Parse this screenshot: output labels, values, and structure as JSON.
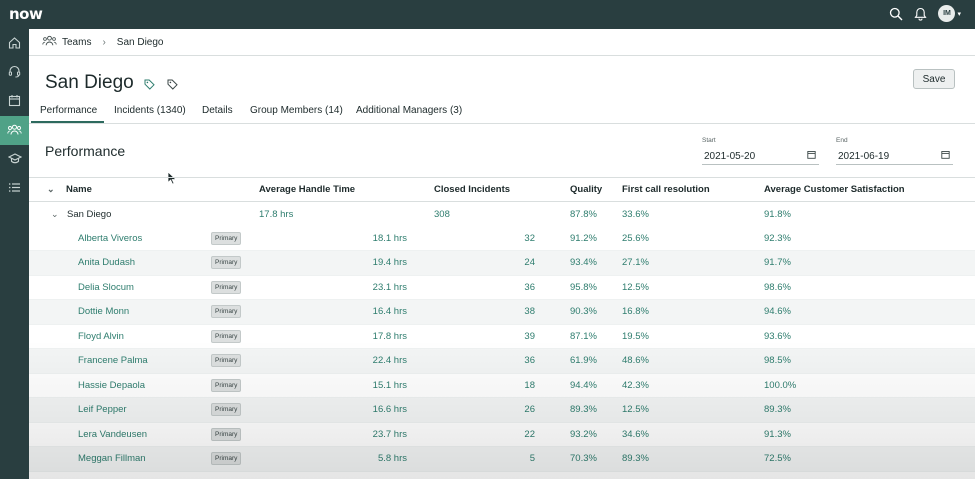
{
  "app": {
    "logo": "now",
    "user_initials": "IM"
  },
  "sidebar": {
    "items": [
      {
        "icon": "home-icon"
      },
      {
        "icon": "headset-icon"
      },
      {
        "icon": "calendar-icon"
      },
      {
        "icon": "teams-icon",
        "active": true
      },
      {
        "icon": "graduation-cap-icon"
      },
      {
        "icon": "list-icon"
      }
    ]
  },
  "breadcrumb": {
    "root": "Teams",
    "current": "San Diego"
  },
  "page": {
    "title": "San Diego",
    "save_label": "Save"
  },
  "tabs": [
    {
      "label": "Performance",
      "active": true
    },
    {
      "label": "Incidents (1340)"
    },
    {
      "label": "Details"
    },
    {
      "label": "Group Members (14)"
    },
    {
      "label": "Additional Managers (3)"
    }
  ],
  "performance": {
    "title": "Performance",
    "start_label": "Start",
    "start_value": "2021-05-20",
    "end_label": "End",
    "end_value": "2021-06-19"
  },
  "table": {
    "columns": {
      "name": "Name",
      "aht": "Average Handle Time",
      "closed": "Closed Incidents",
      "quality": "Quality",
      "fcr": "First call resolution",
      "csat": "Average Customer Satisfaction"
    },
    "group": {
      "name": "San Diego",
      "aht": "17.8 hrs",
      "closed": "308",
      "quality": "87.8%",
      "fcr": "33.6%",
      "csat": "91.8%"
    },
    "rows": [
      {
        "name": "Alberta Viveros",
        "badge": "Primary",
        "aht": "18.1 hrs",
        "closed": "32",
        "quality": "91.2%",
        "fcr": "25.6%",
        "csat": "92.3%"
      },
      {
        "name": "Anita Dudash",
        "badge": "Primary",
        "aht": "19.4 hrs",
        "closed": "24",
        "quality": "93.4%",
        "fcr": "27.1%",
        "csat": "91.7%"
      },
      {
        "name": "Delia Slocum",
        "badge": "Primary",
        "aht": "23.1 hrs",
        "closed": "36",
        "quality": "95.8%",
        "fcr": "12.5%",
        "csat": "98.6%"
      },
      {
        "name": "Dottie Monn",
        "badge": "Primary",
        "aht": "16.4 hrs",
        "closed": "38",
        "quality": "90.3%",
        "fcr": "16.8%",
        "csat": "94.6%"
      },
      {
        "name": "Floyd Alvin",
        "badge": "Primary",
        "aht": "17.8 hrs",
        "closed": "39",
        "quality": "87.1%",
        "fcr": "19.5%",
        "csat": "93.6%"
      },
      {
        "name": "Francene Palma",
        "badge": "Primary",
        "aht": "22.4 hrs",
        "closed": "36",
        "quality": "61.9%",
        "fcr": "48.6%",
        "csat": "98.5%"
      },
      {
        "name": "Hassie Depaola",
        "badge": "Primary",
        "aht": "15.1 hrs",
        "closed": "18",
        "quality": "94.4%",
        "fcr": "42.3%",
        "csat": "100.0%"
      },
      {
        "name": "Leif Pepper",
        "badge": "Primary",
        "aht": "16.6 hrs",
        "closed": "26",
        "quality": "89.3%",
        "fcr": "12.5%",
        "csat": "89.3%"
      },
      {
        "name": "Lera Vandeusen",
        "badge": "Primary",
        "aht": "23.7 hrs",
        "closed": "22",
        "quality": "93.2%",
        "fcr": "34.6%",
        "csat": "91.3%"
      },
      {
        "name": "Meggan Fillman",
        "badge": "Primary",
        "aht": "5.8 hrs",
        "closed": "5",
        "quality": "70.3%",
        "fcr": "89.3%",
        "csat": "72.5%"
      }
    ]
  }
}
